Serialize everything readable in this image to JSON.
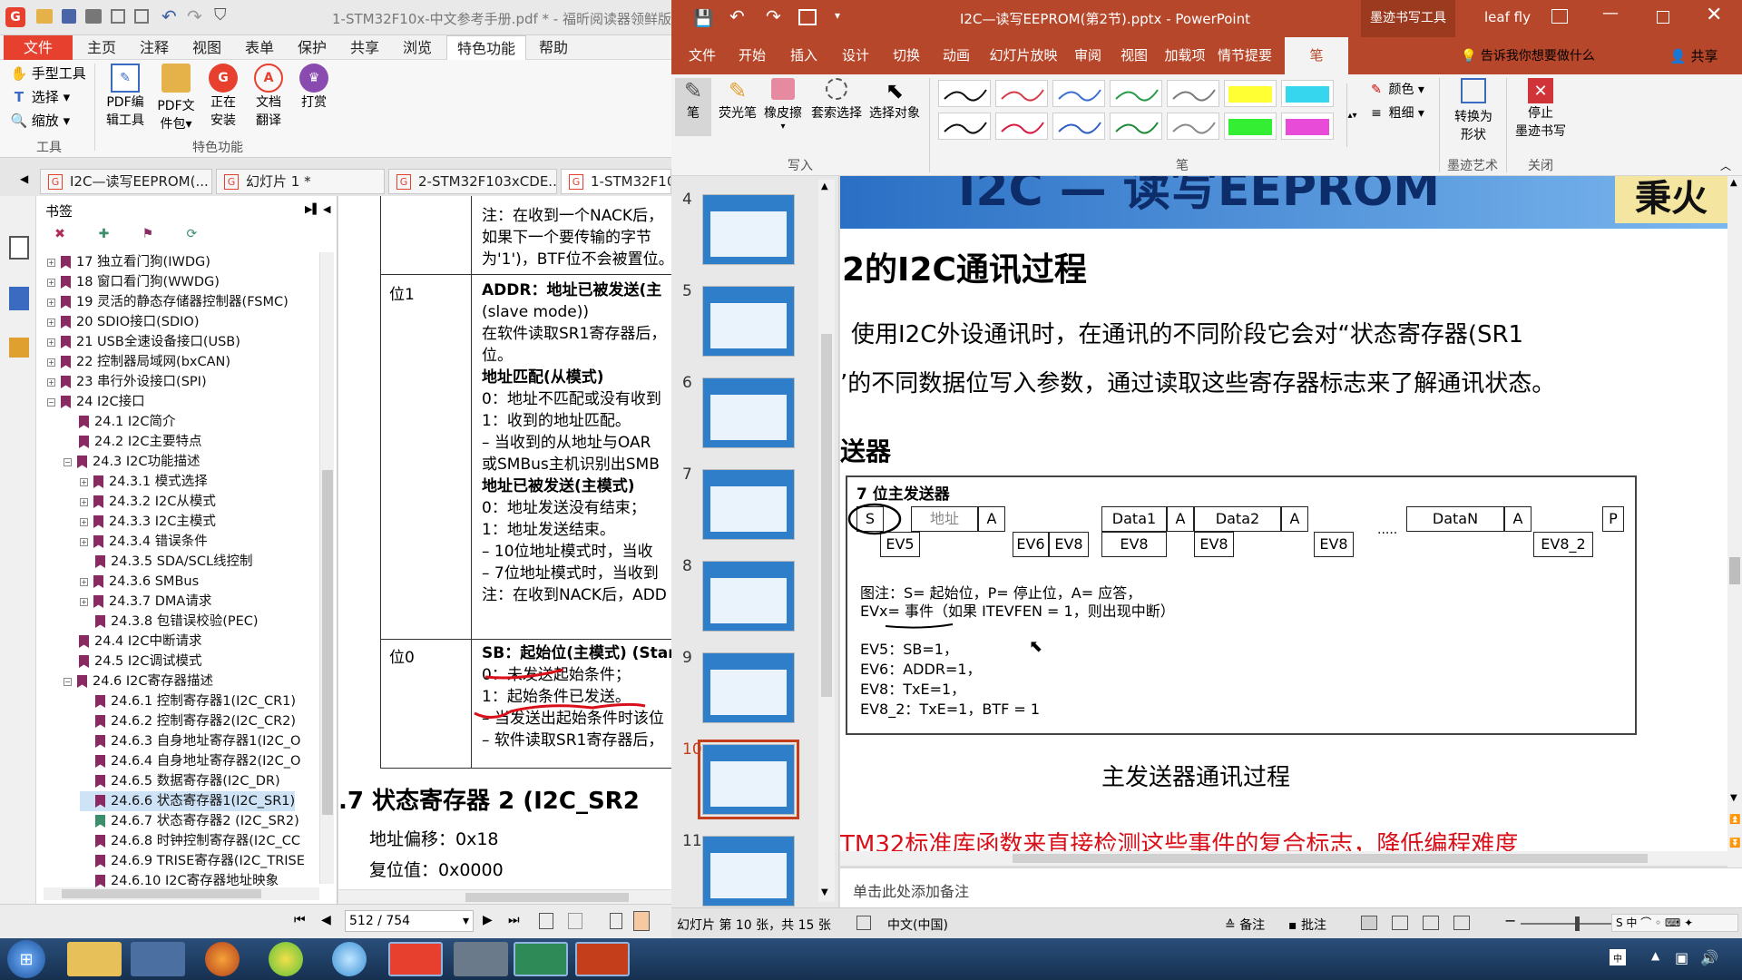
{
  "foxit": {
    "title": "1-STM32F10x-中文参考手册.pdf * - 福昕阅读器领鲜版",
    "menu": [
      "文件",
      "主页",
      "注释",
      "视图",
      "表单",
      "保护",
      "共享",
      "浏览",
      "特色功能",
      "帮助"
    ],
    "active_menu": "特色功能",
    "ribbon": {
      "tools_group_label": "工具",
      "hand_tool": "手型工具",
      "select_tool": "选择",
      "zoom_tool": "缩放",
      "features_group_label": "特色功能",
      "buttons": [
        {
          "line1": "PDF编",
          "line2": "辑工具"
        },
        {
          "line1": "PDF文",
          "line2": "件包"
        },
        {
          "line1": "正在",
          "line2": "安装"
        },
        {
          "line1": "文档",
          "line2": "翻译"
        },
        {
          "line1": "打赏",
          "line2": ""
        }
      ]
    },
    "doc_tabs": [
      "I2C—读写EEPROM(...",
      "幻灯片 1 *",
      "2-STM32F103xCDE...",
      "1-STM32F10x-..."
    ],
    "bookmarks_label": "书签",
    "bookmarks": [
      {
        "text": "17 独立看门狗(IWDG)",
        "level": 0,
        "exp": "+"
      },
      {
        "text": "18 窗口看门狗(WWDG)",
        "level": 0,
        "exp": "+"
      },
      {
        "text": "19 灵活的静态存储器控制器(FSMC)",
        "level": 0,
        "exp": "+"
      },
      {
        "text": "20 SDIO接口(SDIO)",
        "level": 0,
        "exp": "+"
      },
      {
        "text": "21 USB全速设备接口(USB)",
        "level": 0,
        "exp": "+"
      },
      {
        "text": "22 控制器局域网(bxCAN)",
        "level": 0,
        "exp": "+"
      },
      {
        "text": "23 串行外设接口(SPI)",
        "level": 0,
        "exp": "+"
      },
      {
        "text": "24 I2C接口",
        "level": 0,
        "exp": "-"
      },
      {
        "text": "24.1 I2C简介",
        "level": 1,
        "exp": ""
      },
      {
        "text": "24.2 I2C主要特点",
        "level": 1,
        "exp": ""
      },
      {
        "text": "24.3 I2C功能描述",
        "level": 1,
        "exp": "-"
      },
      {
        "text": "24.3.1 模式选择",
        "level": 2,
        "exp": "+"
      },
      {
        "text": "24.3.2 I2C从模式",
        "level": 2,
        "exp": "+"
      },
      {
        "text": "24.3.3 I2C主模式",
        "level": 2,
        "exp": "+"
      },
      {
        "text": "24.3.4 错误条件",
        "level": 2,
        "exp": "+"
      },
      {
        "text": "24.3.5 SDA/SCL线控制",
        "level": 2,
        "exp": ""
      },
      {
        "text": "24.3.6 SMBus",
        "level": 2,
        "exp": "+"
      },
      {
        "text": "24.3.7 DMA请求",
        "level": 2,
        "exp": "+"
      },
      {
        "text": "24.3.8 包错误校验(PEC)",
        "level": 2,
        "exp": ""
      },
      {
        "text": "24.4 I2C中断请求",
        "level": 1,
        "exp": ""
      },
      {
        "text": "24.5 I2C调试模式",
        "level": 1,
        "exp": ""
      },
      {
        "text": "24.6 I2C寄存器描述",
        "level": 1,
        "exp": "-"
      },
      {
        "text": "24.6.1 控制寄存器1(I2C_CR1)",
        "level": 2,
        "exp": ""
      },
      {
        "text": "24.6.2 控制寄存器2(I2C_CR2)",
        "level": 2,
        "exp": ""
      },
      {
        "text": "24.6.3 自身地址寄存器1(I2C_O",
        "level": 2,
        "exp": ""
      },
      {
        "text": "24.6.4 自身地址寄存器2(I2C_O",
        "level": 2,
        "exp": ""
      },
      {
        "text": "24.6.5 数据寄存器(I2C_DR)",
        "level": 2,
        "exp": ""
      },
      {
        "text": "24.6.6 状态寄存器1(I2C_SR1)",
        "level": 2,
        "exp": "",
        "selected": true
      },
      {
        "text": "24.6.7 状态寄存器2 (I2C_SR2)",
        "level": 2,
        "exp": "",
        "green": true
      },
      {
        "text": "24.6.8 时钟控制寄存器(I2C_CC",
        "level": 2,
        "exp": ""
      },
      {
        "text": "24.6.9 TRISE寄存器(I2C_TRISE",
        "level": 2,
        "exp": ""
      },
      {
        "text": "24.6.10 I2C寄存器地址映象",
        "level": 2,
        "exp": ""
      }
    ],
    "doc": {
      "lines_top": [
        "注：在收到一个NACK后，",
        "如果下一个要传输的字节",
        "为'1')，BTF位不会被置位。"
      ],
      "bit1_label": "位1",
      "bit1_lines": [
        "ADDR：地址已被发送(主",
        "(slave mode))",
        "在软件读取SR1寄存器后，",
        "位。",
        "地址匹配(从模式)",
        "0：地址不匹配或没有收到",
        "1：收到的地址匹配。",
        "– 当收到的从地址与OAR",
        "或SMBus主机识别出SMB",
        "地址已被发送(主模式)",
        "0：地址发送没有结束；",
        "1：地址发送结束。",
        "– 10位地址模式时，当收",
        "– 7位地址模式时，当收到",
        "注：在收到NACK后，ADD"
      ],
      "bit0_label": "位0",
      "bit0_lines": [
        "SB：起始位(主模式) (Star",
        "0：未发送起始条件；",
        "1：起始条件已发送。",
        "– 当发送出起始条件时该位",
        "– 软件读取SR1寄存器后，"
      ],
      "section_title": ".7   状态寄存器 2 (I2C_SR2",
      "addr_offset": "地址偏移：0x18",
      "reset_value": "复位值：0x0000"
    },
    "page_indicator": "512 / 754"
  },
  "ppt": {
    "title": "I2C—读写EEPROM(第2节).pptx - PowerPoint",
    "ink_tools_label": "墨迹书写工具",
    "user": "leaf fly",
    "tabs": [
      "文件",
      "开始",
      "插入",
      "设计",
      "切换",
      "动画",
      "幻灯片放映",
      "审阅",
      "视图",
      "加载项",
      "情节提要",
      "笔"
    ],
    "active_tab": "笔",
    "tell_me": "告诉我你想要做什么",
    "share": "共享",
    "ribbon": {
      "write_tools": [
        "笔",
        "荧光笔",
        "橡皮擦",
        "套索选择",
        "选择对象"
      ],
      "write_group": "写入",
      "pens_group": "笔",
      "color_label": "颜色",
      "thickness_label": "粗细",
      "convert_shape": [
        "转换为",
        "形状"
      ],
      "ink_art_group": "墨迹艺术",
      "stop_inking": [
        "停止",
        "墨迹书写"
      ],
      "close_group": "关闭",
      "pen_colors": [
        "#111111",
        "#d63b4a",
        "#3c6fd1",
        "#2b9a4a",
        "#7a7a7a",
        "#ffff33",
        "#36d6ef",
        "#111111",
        "#d81b3f",
        "#2f5fc4",
        "#1e8a3a",
        "#8a8a8a",
        "#33ee33",
        "#e84bd8"
      ]
    },
    "thumb_numbers": [
      "4",
      "5",
      "6",
      "7",
      "8",
      "9",
      "10",
      "11"
    ],
    "selected_thumb": "10",
    "slide": {
      "heading_fragment": "I2C — 读写EEPROM",
      "logo_text": "秉火",
      "section_heading": "2的I2C通讯过程",
      "para_line1": "使用I2C外设通讯时，在通讯的不同阶段它会对“状态寄存器(SR1",
      "para_line2": "’的不同数据位写入参数，通过读取这些寄存器标志来了解通讯状态。",
      "subheading": "送器",
      "diagram_title": "7 位主发送器",
      "seq_top": [
        "S",
        "地址",
        "A",
        "Data1",
        "A",
        "Data2",
        "A",
        "DataN",
        "A",
        "P"
      ],
      "seq_bottom": [
        "EV5",
        "EV6",
        "EV8",
        "EV8",
        "EV8",
        "EV8",
        "EV8_2"
      ],
      "ellipsis": ".....",
      "legend_line1": "图注：S= 起始位，P= 停止位，A= 应答，",
      "legend_line2": "EVx= 事件（如果 ITEVFEN = 1，则出现中断）",
      "events": [
        "EV5：SB=1，",
        "EV6：ADDR=1，",
        "EV8：TxE=1，",
        "EV8_2：TxE=1，BTF = 1"
      ],
      "caption": "主发送器通讯过程",
      "footer_text": "TM32标准库函数来直接检测这些事件的复合标志，降低编程难度"
    },
    "notes_placeholder": "单击此处添加备注",
    "status": {
      "slide_info": "幻灯片 第 10 张，共 15 张",
      "language": "中文(中国)",
      "notes_btn": "备注",
      "comments_btn": "批注"
    }
  }
}
